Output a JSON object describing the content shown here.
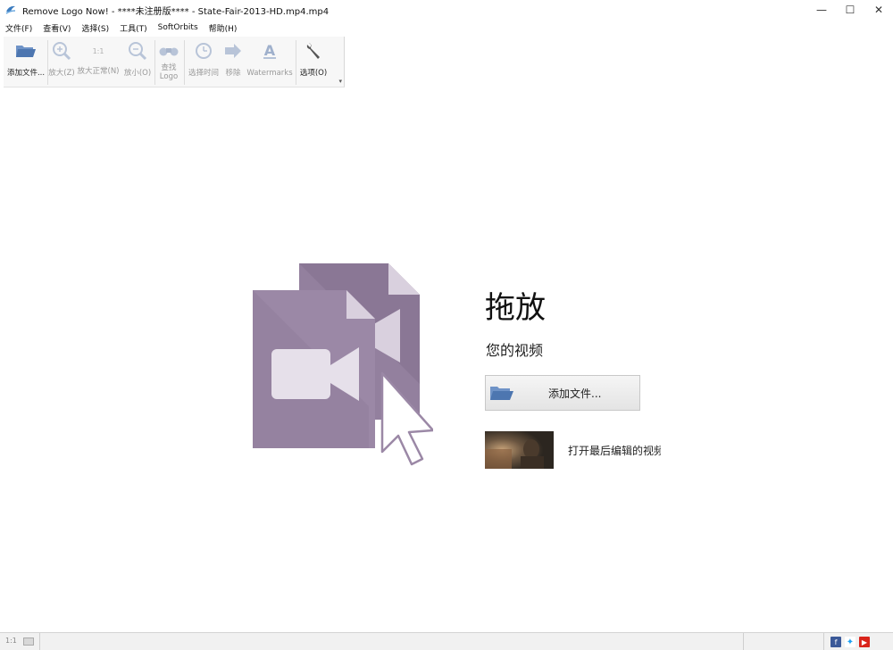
{
  "window": {
    "title": "Remove Logo Now! - ****未注册版**** - State-Fair-2013-HD.mp4.mp4",
    "controls": {
      "minimize": "—",
      "maximize": "☐",
      "close": "✕"
    }
  },
  "menu": {
    "items": [
      {
        "label": "文件(F)"
      },
      {
        "label": "查看(V)"
      },
      {
        "label": "选择(S)"
      },
      {
        "label": "工具(T)"
      },
      {
        "label": "SoftOrbits"
      },
      {
        "label": "帮助(H)"
      }
    ]
  },
  "toolbar": {
    "add_file": "添加文件...",
    "zoom_in": "放大(Z)",
    "actual_size_icon": "1:1",
    "actual_size": "放大正常(N)",
    "zoom_out": "放小(O)",
    "find_logo_1": "查找",
    "find_logo_2": "Logo",
    "select_time": "选择时间",
    "remove": "移除",
    "watermarks": "Watermarks",
    "options": "选项(O)",
    "more": "▾"
  },
  "drop": {
    "title": "拖放",
    "subtitle": "您的视频",
    "add_file_button": "添加文件...",
    "recent_label": "打开最后编辑的视频"
  },
  "status": {
    "zoom": "1:1"
  },
  "colors": {
    "illustration": "#9b88a6",
    "illustration_dark": "#8a7795",
    "illustration_light": "#d9d0de",
    "folder_blue": "#5a7fb5"
  }
}
